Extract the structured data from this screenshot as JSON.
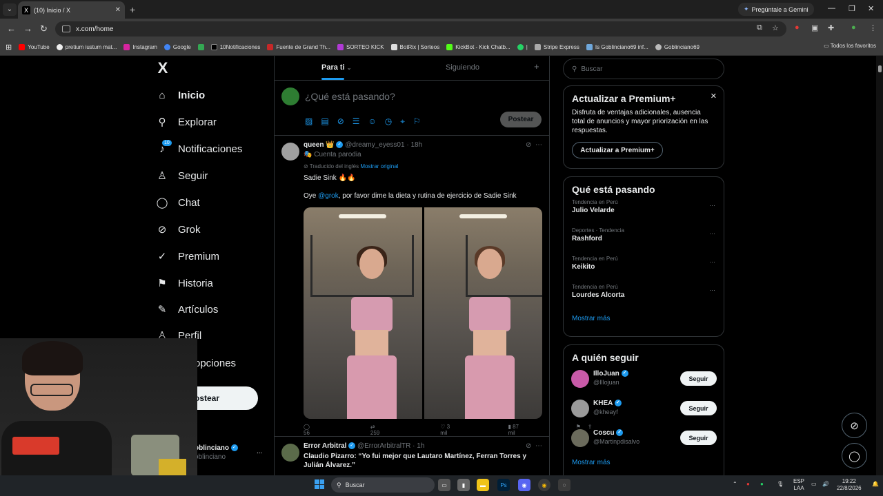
{
  "browser": {
    "tab_title": "(10) Inicio / X",
    "tab_favicon": "X",
    "gemini_label": "Pregúntale a Gemini",
    "url": "x.com/home",
    "bookmarks": [
      "YouTube",
      "pretium iustum mat...",
      "Instagram",
      "Google",
      "",
      "10Notificaciones",
      "Fuente de Grand Th...",
      "SORTEO KICK",
      "BotRix | Sorteos",
      "KickBot - Kick Chatb...",
      "|",
      "Stripe Express",
      "Is Goblinciano69 inf...",
      "Goblinciano69"
    ],
    "bookmarks_right": "Todos los favoritos"
  },
  "sidebar": {
    "logo": "X",
    "items": [
      {
        "label": "Inicio",
        "icon": "home-icon",
        "glyph": "⌂"
      },
      {
        "label": "Explorar",
        "icon": "search-icon",
        "glyph": "⚲"
      },
      {
        "label": "Notificaciones",
        "icon": "bell-icon",
        "glyph": "♪",
        "badge": "10"
      },
      {
        "label": "Seguir",
        "icon": "add-person-icon",
        "glyph": "♙"
      },
      {
        "label": "Chat",
        "icon": "chat-bubble-icon",
        "glyph": "◯"
      },
      {
        "label": "Grok",
        "icon": "grok-icon",
        "glyph": "⊘"
      },
      {
        "label": "Premium",
        "icon": "premium-check-icon",
        "glyph": "✓"
      },
      {
        "label": "Historia",
        "icon": "bookmark-icon",
        "glyph": "⚑"
      },
      {
        "label": "Artículos",
        "icon": "article-icon",
        "glyph": "✎"
      },
      {
        "label": "Perfil",
        "icon": "person-icon",
        "glyph": "♙"
      },
      {
        "label": "opciones",
        "icon": "more-icon",
        "glyph": "⋯"
      }
    ],
    "post_button": "ostear",
    "account_name": "oblinciano",
    "account_handle": "oblinciano",
    "account_more": "..."
  },
  "feed": {
    "tabs": [
      "Para ti",
      "Siguiendo"
    ],
    "compose_placeholder": "¿Qué está pasando?",
    "post_button": "Postear",
    "tweets": [
      {
        "name": "queen",
        "crown": "👑",
        "handle": "@dreamy_eyess01",
        "time": "· 18h",
        "label": "Cuenta parodia",
        "translated": "Traducido del inglés",
        "show_original": "Mostrar original",
        "text1": "Sadie Sink 🔥🔥",
        "text2_pre": "Oye",
        "mention": "@grok",
        "text2_post": ", por favor dime la dieta y rutina de ejercicio de Sadie Sink",
        "replies": "56",
        "reposts": "259",
        "likes": "3 mil",
        "views": "87 mil"
      },
      {
        "name": "Error Arbitral",
        "handle": "@ErrorArbitralTR",
        "time": "· 1h",
        "text": "Claudio Pizarro: “Yo fui mejor que Lautaro Martínez, Ferran Torres y Julián Álvarez.”"
      }
    ]
  },
  "right": {
    "search_placeholder": "Buscar",
    "premium": {
      "title": "Actualizar a Premium+",
      "body": "Disfruta de ventajas adicionales, ausencia total de anuncios y mayor priorización en las respuestas.",
      "button": "Actualizar a Premium+"
    },
    "trends_title": "Qué está pasando",
    "trends": [
      {
        "category": "Tendencia en Perú",
        "name": "Julio Velarde"
      },
      {
        "category": "Deportes · Tendencia",
        "name": "Rashford"
      },
      {
        "category": "Tendencia en Perú",
        "name": "Keikito"
      },
      {
        "category": "Tendencia en Perú",
        "name": "Lourdes Alcorta"
      }
    ],
    "show_more": "Mostrar más",
    "who_to_follow_title": "A quién seguir",
    "follow": [
      {
        "name": "IlloJuan",
        "handle": "@Illojuan",
        "color": "#c85aa8"
      },
      {
        "name": "KHEA",
        "handle": "@kheayf",
        "color": "#9a9a9a"
      },
      {
        "name": "Coscu",
        "handle": "@Martinpdisalvo",
        "color": "#6b6b5c"
      }
    ],
    "follow_button": "Seguir",
    "show_more2": "Mostrar más"
  },
  "taskbar": {
    "search": "Buscar",
    "lang": "ESP",
    "lang2": "LAA",
    "time": "19:22",
    "date": "22/8/2026"
  },
  "colors": {
    "accent": "#1d9bf0",
    "background": "#000000",
    "border": "#2f3336"
  }
}
